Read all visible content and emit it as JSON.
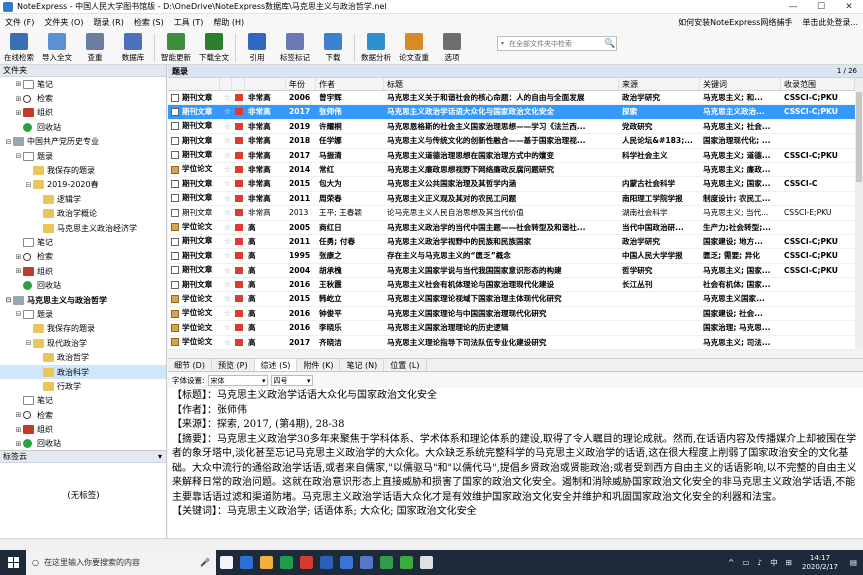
{
  "window": {
    "title": "NoteExpress - 中国人民大学图书馆版 - D:\\OneDrive\\NoteExpress数据库\\马克思主义与政治哲学.nel",
    "controls": [
      "—",
      "☐",
      "✕"
    ]
  },
  "menu": {
    "items": [
      "文件 (F)",
      "文件夹 (O)",
      "题录 (R)",
      "检索 (S)",
      "工具 (T)",
      "帮助 (H)"
    ],
    "right": [
      "如何安装NoteExpress网络捕手",
      "单击此处登录..."
    ]
  },
  "toolbar": {
    "buttons": [
      {
        "label": "在线检索",
        "color": "#3a6fb5"
      },
      {
        "label": "导入全文",
        "color": "#5b8fd6"
      },
      {
        "label": "查重",
        "color": "#6a7fa0"
      },
      {
        "label": "数据库",
        "color": "#4b71b8"
      },
      {
        "label": "智能更新",
        "color": "#3c8d3c"
      },
      {
        "label": "下载全文",
        "color": "#2c7d2c"
      },
      {
        "label": "引用",
        "color": "#2f67c2"
      },
      {
        "label": "标签标记",
        "color": "#6a79b3"
      },
      {
        "label": "下载",
        "color": "#3d7fd0"
      },
      {
        "label": "数据分析",
        "color": "#2f8fd2"
      },
      {
        "label": "论文查重",
        "color": "#d88a26"
      },
      {
        "label": "选项",
        "color": "#6d6d6d"
      }
    ],
    "search_placeholder": "在全部文件夹中检索",
    "search_dropdown": "▾",
    "search_icon": "🔍"
  },
  "left_panel": {
    "header": "文件夹",
    "tree": [
      {
        "indent": 1,
        "exp": "⊞",
        "icon": "note",
        "label": "笔记"
      },
      {
        "indent": 1,
        "exp": "⊞",
        "icon": "search",
        "label": "检索"
      },
      {
        "indent": 1,
        "exp": "⊞",
        "icon": "group",
        "label": "组织"
      },
      {
        "indent": 1,
        "exp": "",
        "icon": "recycle",
        "label": "回收站"
      },
      {
        "indent": 0,
        "exp": "⊟",
        "icon": "db",
        "label": "中国共产党历史专业"
      },
      {
        "indent": 1,
        "exp": "⊟",
        "icon": "note",
        "label": "题录"
      },
      {
        "indent": 2,
        "exp": "",
        "icon": "folder",
        "label": "我保存的题录"
      },
      {
        "indent": 2,
        "exp": "⊟",
        "icon": "folder",
        "label": "2019-2020春"
      },
      {
        "indent": 3,
        "exp": "",
        "icon": "folder",
        "label": "逻辑学"
      },
      {
        "indent": 3,
        "exp": "",
        "icon": "folder",
        "label": "政治学概论"
      },
      {
        "indent": 3,
        "exp": "",
        "icon": "folder",
        "label": "马克思主义政治经济学"
      },
      {
        "indent": 1,
        "exp": "",
        "icon": "note",
        "label": "笔记"
      },
      {
        "indent": 1,
        "exp": "⊞",
        "icon": "search",
        "label": "检索"
      },
      {
        "indent": 1,
        "exp": "⊞",
        "icon": "group",
        "label": "组织"
      },
      {
        "indent": 1,
        "exp": "",
        "icon": "recycle",
        "label": "回收站"
      },
      {
        "indent": 0,
        "exp": "⊟",
        "icon": "db",
        "label": "马克思主义与政治哲学",
        "bold": true
      },
      {
        "indent": 1,
        "exp": "⊟",
        "icon": "note",
        "label": "题录"
      },
      {
        "indent": 2,
        "exp": "",
        "icon": "folder",
        "label": "我保存的题录"
      },
      {
        "indent": 2,
        "exp": "⊟",
        "icon": "folder",
        "label": "现代政治学"
      },
      {
        "indent": 3,
        "exp": "",
        "icon": "folder",
        "label": "政治哲学"
      },
      {
        "indent": 3,
        "exp": "",
        "icon": "folder",
        "label": "政治科学",
        "selected": true
      },
      {
        "indent": 3,
        "exp": "",
        "icon": "folder",
        "label": "行政学"
      },
      {
        "indent": 1,
        "exp": "",
        "icon": "note",
        "label": "笔记"
      },
      {
        "indent": 1,
        "exp": "⊞",
        "icon": "search",
        "label": "检索"
      },
      {
        "indent": 1,
        "exp": "⊞",
        "icon": "group",
        "label": "组织"
      },
      {
        "indent": 1,
        "exp": "⊞",
        "icon": "recycle",
        "label": "回收站"
      }
    ]
  },
  "tag_cloud": {
    "header": "标签云",
    "empty": "(无标签)"
  },
  "main": {
    "header": "题录",
    "page_info": "1 / 26",
    "columns": [
      "",
      "",
      "",
      "",
      "年份",
      "作者",
      "标题",
      "来源",
      "关键词",
      "收录范围"
    ],
    "rows": [
      {
        "type": "期刊文章",
        "icon": "journal",
        "pri": "非常高",
        "year": "2006",
        "author": "曾宇辉",
        "title": "马克思主义关于和谐社会的核心命题：人的自由与全面发展",
        "source": "政治学研究",
        "keywords": "马克思主义; 和...",
        "range": "CSSCI-C;PKU",
        "bold": true
      },
      {
        "type": "期刊文章",
        "icon": "journal",
        "pri": "非常高",
        "year": "2017",
        "author": "张师伟",
        "title": "马克思主义政治学话语大众化与国家政治文化安全",
        "source": "探索",
        "keywords": "马克思主义政治...",
        "range": "CSSCI-C;PKU",
        "bold": true,
        "selected": true
      },
      {
        "type": "期刊文章",
        "icon": "journal",
        "pri": "非常高",
        "year": "2019",
        "author": "许耀桐",
        "title": "马克思恩格斯的社会主义国家治理思想——学习《法兰西...",
        "source": "党政研究",
        "keywords": "马克思主义; 社会...",
        "range": "",
        "bold": true
      },
      {
        "type": "期刊文章",
        "icon": "journal",
        "pri": "非常高",
        "year": "2018",
        "author": "任学娜",
        "title": "马克思主义与传统文化的创新性融合——基于国家治理视...",
        "source": "人民论坛&#183;...",
        "keywords": "国家治理现代化; ...",
        "range": "",
        "bold": true
      },
      {
        "type": "期刊文章",
        "icon": "journal",
        "pri": "非常高",
        "year": "2017",
        "author": "马振清",
        "title": "马克思主义道德治理思想在国家治理方式中的嬗变",
        "source": "科学社会主义",
        "keywords": "马克思主义; 道德...",
        "range": "CSSCI-C;PKU",
        "bold": true
      },
      {
        "type": "学位论文",
        "icon": "thesis",
        "pri": "非常高",
        "year": "2014",
        "author": "常红",
        "title": "马克思主义廉政思想视野下网络廉政反腐问题研究",
        "source": "",
        "keywords": "马克思主义; 廉政...",
        "range": "",
        "bold": true
      },
      {
        "type": "期刊文章",
        "icon": "journal",
        "pri": "非常高",
        "year": "2015",
        "author": "包大为",
        "title": "马克思主义公共国家治理及其哲学内涵",
        "source": "内蒙古社会科学",
        "keywords": "马克思主义; 国家...",
        "range": "CSSCI-C",
        "bold": true
      },
      {
        "type": "期刊文章",
        "icon": "journal",
        "pri": "非常高",
        "year": "2011",
        "author": "周荣春",
        "title": "马克思主义正义观及其对的农民工问题",
        "source": "南阳理工学院学报",
        "keywords": "制度设计; 农民工...",
        "range": "",
        "bold": true
      },
      {
        "type": "期刊文章",
        "icon": "journal",
        "pri": "非常高",
        "year": "2013",
        "author": "王平; 王春颖",
        "title": "论马克思主义人民自治思想及其当代价值",
        "source": "湖南社会科学",
        "keywords": "马克思主义; 当代...",
        "range": "CSSCI-E;PKU",
        "bold": false
      },
      {
        "type": "学位论文",
        "icon": "thesis",
        "pri": "高",
        "year": "2005",
        "author": "商红日",
        "title": "马克思主义政治学的当代中国主题——社会转型及和谐社...",
        "source": "当代中国政治研...",
        "keywords": "生产力;社会转型;...",
        "range": "",
        "bold": true
      },
      {
        "type": "期刊文章",
        "icon": "journal",
        "pri": "高",
        "year": "2011",
        "author": "任勇; 付春",
        "title": "马克思主义政治学视野中的民族和民族国家",
        "source": "政治学研究",
        "keywords": "国家建设; 地方...",
        "range": "CSSCI-C;PKU",
        "bold": true
      },
      {
        "type": "期刊文章",
        "icon": "journal",
        "pri": "高",
        "year": "1995",
        "author": "张康之",
        "title": "存在主义与马克思主义的“匮乏”概念",
        "source": "中国人民大学学报",
        "keywords": "匮乏; 需要; 异化",
        "range": "CSSCI-C;PKU",
        "bold": true
      },
      {
        "type": "期刊文章",
        "icon": "journal",
        "pri": "高",
        "year": "2004",
        "author": "胡承槐",
        "title": "马克思主义国家学说与当代我国国家意识形态的构建",
        "source": "哲学研究",
        "keywords": "马克思主义; 国家...",
        "range": "CSSCI-C;PKU",
        "bold": true
      },
      {
        "type": "期刊文章",
        "icon": "journal",
        "pri": "高",
        "year": "2016",
        "author": "王秋霞",
        "title": "马克思主义社会有机体理论与国家治理现代化建设",
        "source": "长江丛刊",
        "keywords": "社会有机体; 国家...",
        "range": "",
        "bold": true
      },
      {
        "type": "学位论文",
        "icon": "thesis",
        "pri": "高",
        "year": "2015",
        "author": "韩屹立",
        "title": "马克思主义国家理论视域下国家治理主体现代化研究",
        "source": "",
        "keywords": "马克思主义国家...",
        "range": "",
        "bold": true
      },
      {
        "type": "学位论文",
        "icon": "thesis",
        "pri": "高",
        "year": "2016",
        "author": "钟俊平",
        "title": "马克思主义国家理论与中国国家治理现代化研究",
        "source": "",
        "keywords": "国家建设; 社会...",
        "range": "",
        "bold": true
      },
      {
        "type": "学位论文",
        "icon": "thesis",
        "pri": "高",
        "year": "2016",
        "author": "李晓乐",
        "title": "马克思主义国家治理理论的历史逻辑",
        "source": "",
        "keywords": "国家治理; 马克思...",
        "range": "",
        "bold": true
      },
      {
        "type": "学位论文",
        "icon": "thesis",
        "pri": "高",
        "year": "2017",
        "author": "齐晓洁",
        "title": "马克思主义理论指导下司法队伍专业化建设研究",
        "source": "",
        "keywords": "马克思主义; 司法...",
        "range": "",
        "bold": true
      }
    ]
  },
  "detail_tabs": [
    "细节 (D)",
    "预览 (P)",
    "综述 (S)",
    "附件 (K)",
    "笔记 (N)",
    "位置 (L)"
  ],
  "detail_active": 2,
  "fontbar": {
    "label": "字体设置:",
    "font": "宋体",
    "size": "四号"
  },
  "abstract": {
    "title_label": "【标题】：",
    "title": "马克思主义政治学话语大众化与国家政治文化安全",
    "author_label": "【作者】：",
    "author": "张师伟",
    "source_label": "【来源】：",
    "source": "探索, 2017, (第4期), 28-38",
    "abstract_label": "【摘要】：",
    "abstract": "马克思主义政治学30多年来聚焦于学科体系、学术体系和理论体系的建设,取得了令人瞩目的理论成就。然而,在话语内容及传播媒介上却被围在学者的象牙塔中,淡化甚至忘记马克思主义政治学的大众化。大众缺乏系统完整科学的马克思主义政治学的话语,这在很大程度上削弱了国家政治安全的文化基础。大众中流行的通俗政治学话语,或者来自儒家,\"以儒驱马\"和\"以儒代马\",提倡乡贤政治或贤能政治;或者受到西方自由主义的话语影响,以不完整的自由主义来解释日常的政治问题。这就在政治意识形态上直接威胁和损害了国家的政治文化安全。遏制和消除威胁国家政治文化安全的非马克思主义政治学话语,不能主要靠话语过滤和渠道防堵。马克思主义政治学话语大众化才是有效维护国家政治文化安全并维护和巩固国家政治文化安全的利器和法宝。",
    "kw_label": "【关键词】：",
    "keywords": "马克思主义政治学; 话语体系; 大众化; 国家政治文化安全"
  },
  "taskbar": {
    "search_text": "在这里输入你要搜索的内容",
    "apps": [
      "#f4f4f4",
      "#2e6fd6",
      "#f2b03d",
      "#1f9b4e",
      "#d63b2f",
      "#2b5fb8",
      "#3b73d6",
      "#5577c8",
      "#2f9d49",
      "#3caa3c",
      "#e0e0e0"
    ],
    "ime": "中",
    "time": "14:17",
    "date": "2020/2/17"
  }
}
